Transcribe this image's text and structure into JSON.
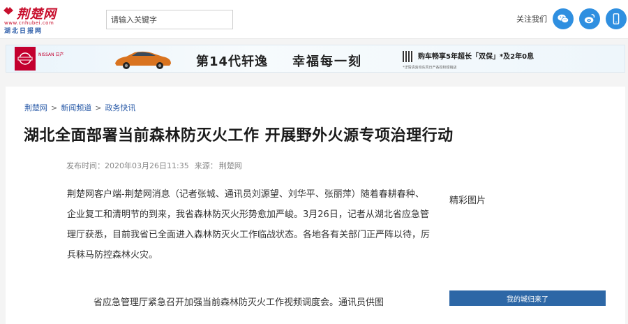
{
  "header": {
    "logo_title": "荆楚网",
    "logo_domain": "www.cnhubei.com",
    "logo_paper": "湖北日报网",
    "search_placeholder": "请输入关键字",
    "follow_label": "关注我们"
  },
  "ad": {
    "brand_tag": "NISSAN 日产",
    "headline": "第14代轩逸",
    "headline2": "幸福每一刻",
    "promo": "购车畅享5年超长「双保」*及2年0息",
    "fine_print": "*详情请咨询东风日产各授权经销店"
  },
  "breadcrumb": [
    "荆楚网",
    "新闻频道",
    "政务快讯"
  ],
  "breadcrumb_sep": ">",
  "article": {
    "title": "湖北全面部署当前森林防灭火工作 开展野外火源专项治理行动",
    "published_label": "发布时间：2020年03月26日11:35",
    "source_label": "来源：",
    "source": "荆楚网",
    "body": "荆楚网客户端-荆楚网消息（记者张城、通讯员刘源望、刘华平、张丽萍）随着春耕春种、企业复工和清明节的到来，我省森林防灭火形势愈加严峻。3月26日，记者从湖北省应急管理厅获悉，目前我省已全面进入森林防灭火工作临战状态。各地各有关部门正严阵以待，厉兵秣马防控森林火灾。",
    "caption": "省应急管理厅紧急召开加强当前森林防灭火工作视频调度会。通讯员供图"
  },
  "sidebar": {
    "title": "精彩图片",
    "button_label": "我的城归来了"
  },
  "colors": {
    "brand_red": "#c8102e",
    "link_blue": "#2a5ba8",
    "social_blue": "#2f8fe0",
    "button_blue": "#2d67a6"
  },
  "icons": [
    "wechat-icon",
    "weibo-icon",
    "mobile-icon"
  ]
}
